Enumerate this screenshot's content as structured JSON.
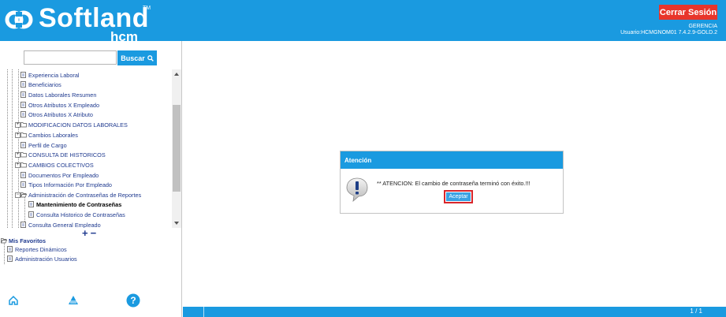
{
  "header": {
    "brand": "Softland",
    "brand_sub": "hcm",
    "trademark": "TM",
    "logout_label": "Cerrar Sesión",
    "role": "GERENCIA",
    "user_line": "Usuario:HCMGNOM01 7.4.2.9-GOLD.2",
    "colors": {
      "bar": "#1a9ae0",
      "logout": "#e8352b"
    }
  },
  "search": {
    "placeholder": "",
    "value": "",
    "button_label": "Buscar"
  },
  "tree": {
    "items": [
      {
        "label": "Experiencia Laboral",
        "icon": "document-icon"
      },
      {
        "label": "Beneficiarios",
        "icon": "document-icon"
      },
      {
        "label": "Datos Laborales Resumen",
        "icon": "document-icon"
      },
      {
        "label": "Otros Atributos X Empleado",
        "icon": "document-icon"
      },
      {
        "label": "Otros Atributos X Atributo",
        "icon": "document-icon"
      },
      {
        "label": "MODIFICACION DATOS LABORALES",
        "icon": "folder-icon"
      },
      {
        "label": "Cambios Laborales",
        "icon": "folder-icon"
      },
      {
        "label": "Perfil de Cargo",
        "icon": "document-icon"
      },
      {
        "label": "CONSULTA DE HISTORICOS",
        "icon": "folder-icon"
      },
      {
        "label": "CAMBIOS COLECTIVOS",
        "icon": "folder-icon"
      },
      {
        "label": "Documentos Por Empleado",
        "icon": "document-icon"
      },
      {
        "label": "Tipos Información Por Empleado",
        "icon": "document-icon"
      },
      {
        "label": "Administración de Contraseñas de Reportes",
        "icon": "folder-open-icon"
      },
      {
        "label": "Mantenimiento de Contraseñas",
        "icon": "document-icon"
      },
      {
        "label": "Consulta Historico de Contraseñas",
        "icon": "document-icon"
      },
      {
        "label": "Consulta General Empleado",
        "icon": "document-icon"
      }
    ],
    "expand_all": "+",
    "collapse_all": "−"
  },
  "favorites": {
    "title": "Mis Favoritos",
    "items": [
      {
        "label": "Reportes Dinámicos"
      },
      {
        "label": "Administración Usuarios"
      }
    ]
  },
  "dialog": {
    "title": "Atención",
    "message": "** ATENCION: El cambio de contraseña terminó con éxito.!!!",
    "ok_label": "Aceptar",
    "icon": "warning-speech-icon"
  },
  "footer": {
    "page_indicator": "1 / 1"
  },
  "bottom_icons": [
    "home-icon",
    "collapse-up-icon",
    "help-icon"
  ]
}
